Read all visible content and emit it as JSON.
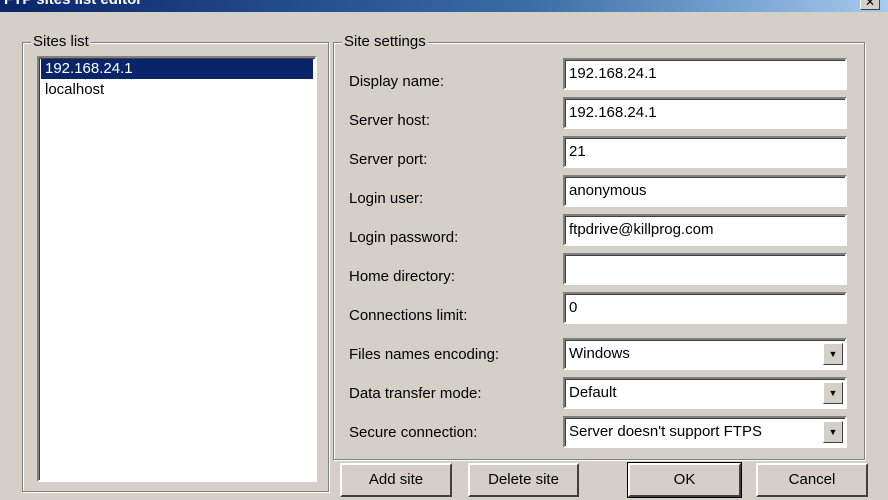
{
  "window": {
    "title": "FTP sites list editor",
    "close_icon": "close-icon"
  },
  "sites_list": {
    "legend": "Sites list",
    "items": [
      {
        "label": "192.168.24.1",
        "selected": true
      },
      {
        "label": "localhost",
        "selected": false
      }
    ]
  },
  "site_settings": {
    "legend": "Site settings",
    "fields": [
      {
        "label": "Display name:",
        "value": "192.168.24.1"
      },
      {
        "label": "Server host:",
        "value": "192.168.24.1"
      },
      {
        "label": "Server port:",
        "value": "21"
      },
      {
        "label": "Login user:",
        "value": "anonymous"
      },
      {
        "label": "Login password:",
        "value": "ftpdrive@killprog.com"
      },
      {
        "label": "Home directory:",
        "value": ""
      },
      {
        "label": "Connections limit:",
        "value": "0"
      },
      {
        "label": "Files names encoding:",
        "value": "Windows"
      },
      {
        "label": "Data transfer mode:",
        "value": "Default"
      },
      {
        "label": "Secure connection:",
        "value": "Server doesn't support FTPS"
      }
    ]
  },
  "buttons": {
    "add": "Add site",
    "delete": "Delete site",
    "ok": "OK",
    "cancel": "Cancel"
  }
}
